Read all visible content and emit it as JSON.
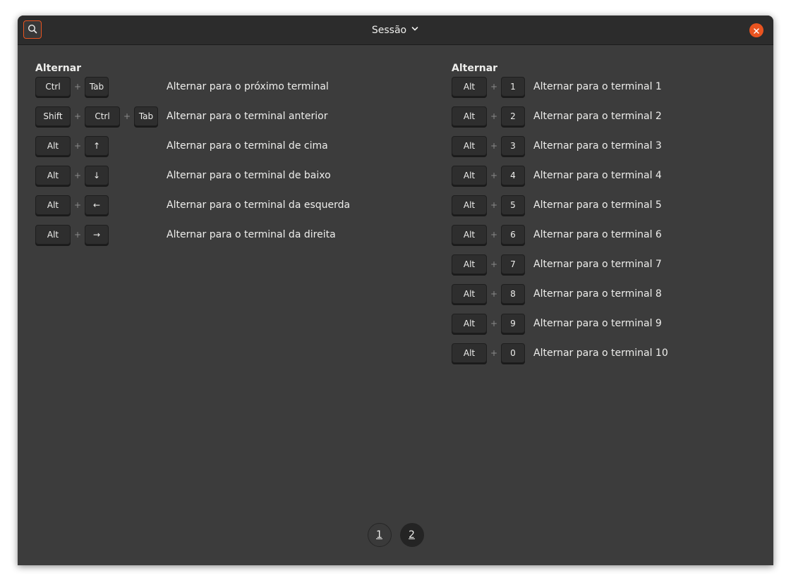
{
  "header": {
    "title": "Sessão",
    "search_icon": "search-icon",
    "dropdown_icon": "chevron-down-icon",
    "close_icon": "close-icon",
    "accent_color": "#e95420"
  },
  "left_section": {
    "title": "Alternar",
    "shortcuts": [
      {
        "keys": [
          "Ctrl",
          "Tab"
        ],
        "description": "Alternar para o próximo terminal"
      },
      {
        "keys": [
          "Shift",
          "Ctrl",
          "Tab"
        ],
        "description": "Alternar para o terminal anterior"
      },
      {
        "keys": [
          "Alt",
          "↑"
        ],
        "description": "Alternar para o terminal de cima"
      },
      {
        "keys": [
          "Alt",
          "↓"
        ],
        "description": "Alternar para o terminal de baixo"
      },
      {
        "keys": [
          "Alt",
          "←"
        ],
        "description": "Alternar para o terminal da esquerda"
      },
      {
        "keys": [
          "Alt",
          "→"
        ],
        "description": "Alternar para o terminal da direita"
      }
    ]
  },
  "right_section": {
    "title": "Alternar",
    "shortcuts": [
      {
        "keys": [
          "Alt",
          "1"
        ],
        "description": "Alternar para o terminal 1"
      },
      {
        "keys": [
          "Alt",
          "2"
        ],
        "description": "Alternar para o terminal 2"
      },
      {
        "keys": [
          "Alt",
          "3"
        ],
        "description": "Alternar para o terminal 3"
      },
      {
        "keys": [
          "Alt",
          "4"
        ],
        "description": "Alternar para o terminal 4"
      },
      {
        "keys": [
          "Alt",
          "5"
        ],
        "description": "Alternar para o terminal 5"
      },
      {
        "keys": [
          "Alt",
          "6"
        ],
        "description": "Alternar para o terminal 6"
      },
      {
        "keys": [
          "Alt",
          "7"
        ],
        "description": "Alternar para o terminal 7"
      },
      {
        "keys": [
          "Alt",
          "8"
        ],
        "description": "Alternar para o terminal 8"
      },
      {
        "keys": [
          "Alt",
          "9"
        ],
        "description": "Alternar para o terminal 9"
      },
      {
        "keys": [
          "Alt",
          "0"
        ],
        "description": "Alternar para o terminal 10"
      }
    ]
  },
  "pagination": {
    "pages": [
      "1",
      "2"
    ],
    "current": "2"
  },
  "plus_sign": "+"
}
